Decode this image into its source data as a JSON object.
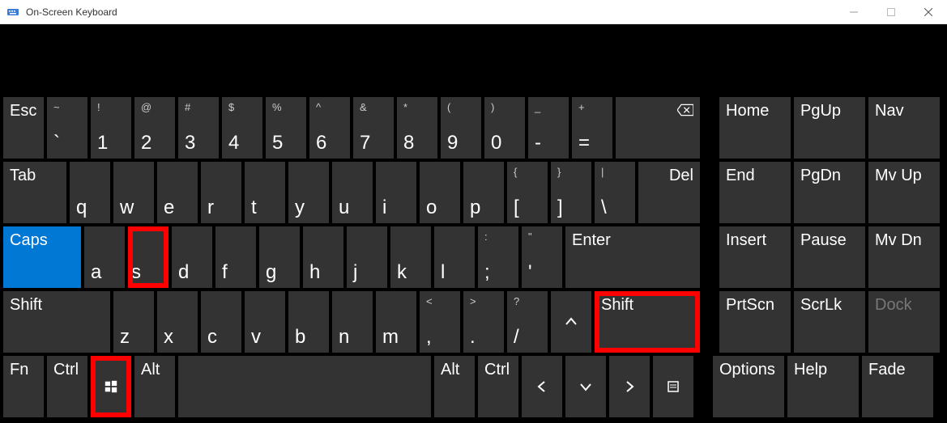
{
  "window": {
    "title": "On-Screen Keyboard"
  },
  "keys": {
    "esc": "Esc",
    "tab": "Tab",
    "caps": "Caps",
    "lshift": "Shift",
    "rshift": "Shift",
    "fn": "Fn",
    "lctrl": "Ctrl",
    "lalt": "Alt",
    "ralt": "Alt",
    "rctrl": "Ctrl",
    "del": "Del",
    "enter": "Enter",
    "home": "Home",
    "pgup": "PgUp",
    "nav": "Nav",
    "end": "End",
    "pgdn": "PgDn",
    "mvup": "Mv Up",
    "insert": "Insert",
    "pause": "Pause",
    "mvdn": "Mv Dn",
    "prtscn": "PrtScn",
    "scrlk": "ScrLk",
    "dock": "Dock",
    "options": "Options",
    "help": "Help",
    "fade": "Fade"
  },
  "row1": [
    {
      "u": "~",
      "l": "`"
    },
    {
      "u": "!",
      "l": "1"
    },
    {
      "u": "@",
      "l": "2"
    },
    {
      "u": "#",
      "l": "3"
    },
    {
      "u": "$",
      "l": "4"
    },
    {
      "u": "%",
      "l": "5"
    },
    {
      "u": "^",
      "l": "6"
    },
    {
      "u": "&",
      "l": "7"
    },
    {
      "u": "*",
      "l": "8"
    },
    {
      "u": "(",
      "l": "9"
    },
    {
      "u": ")",
      "l": "0"
    },
    {
      "u": "_",
      "l": "-"
    },
    {
      "u": "+",
      "l": "="
    }
  ],
  "row2_letters": [
    "q",
    "w",
    "e",
    "r",
    "t",
    "y",
    "u",
    "i",
    "o",
    "p"
  ],
  "row2_sym": [
    {
      "u": "{",
      "l": "["
    },
    {
      "u": "}",
      "l": "]"
    },
    {
      "u": "|",
      "l": "\\"
    }
  ],
  "row3_letters": [
    "a",
    "s",
    "d",
    "f",
    "g",
    "h",
    "j",
    "k",
    "l"
  ],
  "row3_sym": [
    {
      "u": ":",
      "l": ";"
    },
    {
      "u": "\"",
      "l": "'"
    }
  ],
  "row4_letters": [
    "z",
    "x",
    "c",
    "v",
    "b",
    "n",
    "m"
  ],
  "row4_sym": [
    {
      "u": "<",
      "l": ","
    },
    {
      "u": ">",
      "l": "."
    },
    {
      "u": "?",
      "l": "/"
    }
  ]
}
